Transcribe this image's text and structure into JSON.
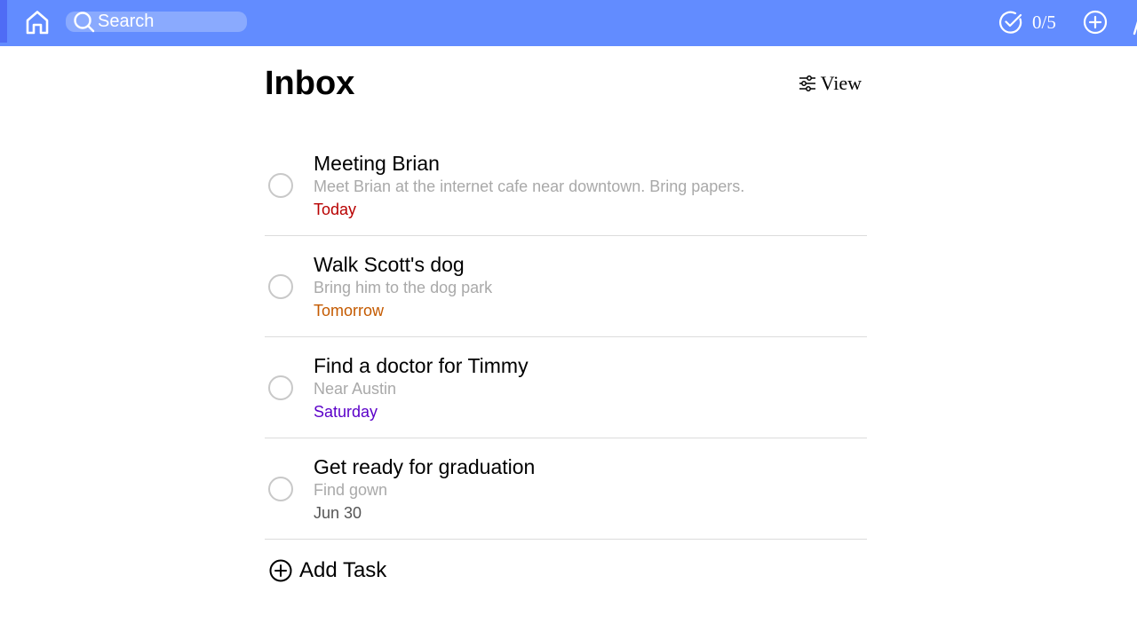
{
  "header": {
    "home_icon": "home-icon",
    "search": {
      "placeholder": "Search",
      "icon": "search-icon"
    },
    "progress": {
      "icon": "check-circle-icon",
      "text": "0/5"
    },
    "add_icon": "plus-circle-icon",
    "colors": {
      "bar": "#628cff",
      "search_bg": "#8aaafe",
      "text": "#ffffff"
    }
  },
  "main": {
    "title": "Inbox",
    "view": {
      "icon": "sliders-icon",
      "label": "View"
    },
    "tasks": [
      {
        "title": "Meeting Brian",
        "description": "Meet Brian at the internet cafe near downtown. Bring papers.",
        "due": "Today",
        "due_color": "#b80000"
      },
      {
        "title": "Walk Scott's dog",
        "description": "Bring him to the dog park",
        "due": "Tomorrow",
        "due_color": "#c45a00"
      },
      {
        "title": "Find a doctor for Timmy",
        "description": "Near Austin",
        "due": "Saturday",
        "due_color": "#5b00c9"
      },
      {
        "title": "Get ready for graduation",
        "description": "Find gown",
        "due": "Jun 30",
        "due_color": "#555555"
      }
    ],
    "add_task": {
      "icon": "plus-circle-icon",
      "label": "Add Task"
    }
  }
}
